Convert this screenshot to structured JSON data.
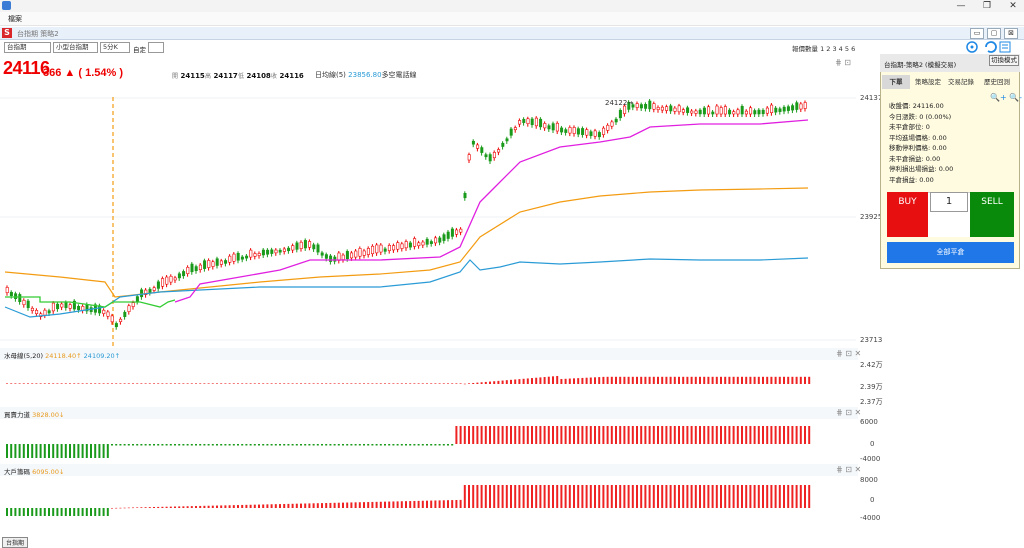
{
  "window": {
    "title": "",
    "min": "—",
    "max": "❐",
    "close": "✕"
  },
  "menu": {
    "file": "檔案"
  },
  "subwindow": {
    "icon": "S",
    "title": "台指期 策略2",
    "buttons": [
      "▭",
      "▢",
      "⊠"
    ]
  },
  "toolbar": {
    "symbol": "台指期",
    "product": "小型台指期",
    "interval": "5分K",
    "custom_label": "自定",
    "qty_label": "報價數量 1 2 3 4 5 6"
  },
  "quote": {
    "last": "24116",
    "change": "366 ▲ ( 1.54% )",
    "open_label": "開",
    "open": "24115",
    "high_label": "高",
    "high": "24117",
    "low_label": "低",
    "low": "24108",
    "close_label": "收",
    "close": "24116",
    "ma_label": "日均線(5)",
    "ma_value": "23856.80",
    "ma_signal": "多空電話線"
  },
  "chart": {
    "marker_label": "24122→",
    "y_top": "24137",
    "y_mid": "23925",
    "y_bottom": "23713"
  },
  "panes": [
    {
      "name": "水母線(5,20)",
      "v1": "24118.40↑",
      "v2": "24109.20↑",
      "y": [
        "2.42万",
        "2.39万",
        "2.37万"
      ]
    },
    {
      "name": "買賣力道",
      "v1": "3828.00↓",
      "y": [
        "6000",
        "0",
        "-4000"
      ]
    },
    {
      "name": "大戶籌碼",
      "v1": "6095.00↓",
      "y": [
        "8000",
        "0",
        "-4000"
      ]
    }
  ],
  "panel": {
    "title": "台指期-策略2 (模擬交易)",
    "switch_label": "切換模式",
    "tabs": [
      "下單",
      "策略設定",
      "交易記錄",
      "歷史回測"
    ],
    "info": [
      "收盤價: 24116.00",
      "今日漲跌: 0 (0.00%)",
      "未平倉部位: 0",
      "平均進場價格: 0.00",
      "移動停利價格: 0.00",
      "未平倉損益: 0.00",
      "停利損出場損益: 0.00",
      "平倉損益: 0.00"
    ],
    "buy": "BUY",
    "qty": "1",
    "sell": "SELL",
    "close_all": "全部平倉"
  },
  "bottom_tab": "台指期",
  "colors": {
    "up": "#e00000",
    "down": "#1a9a1a",
    "panel": "#fffbe0"
  }
}
